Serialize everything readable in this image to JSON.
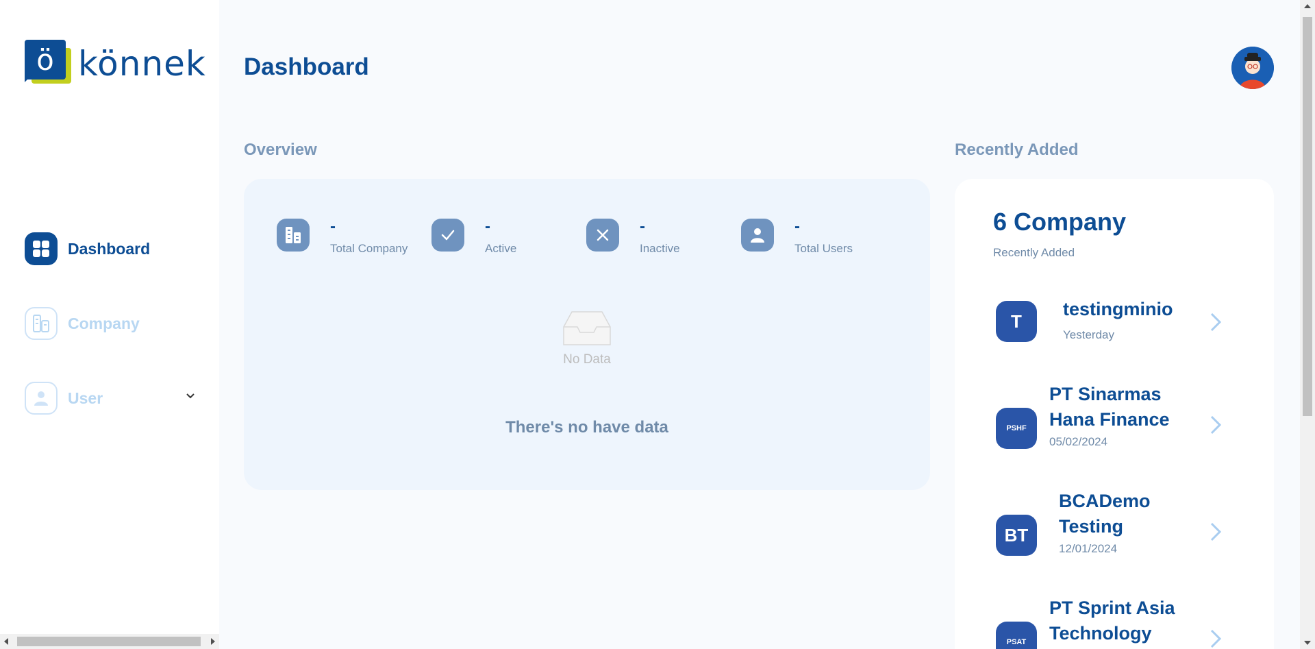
{
  "brand": {
    "name": "könnek",
    "mark": "ö",
    "colors": {
      "primary": "#0d4d94",
      "accent": "#c2cf1e",
      "muted": "#b8d7f2"
    }
  },
  "sidebar": {
    "items": [
      {
        "label": "Dashboard",
        "icon": "dashboard-grid-icon",
        "active": true
      },
      {
        "label": "Company",
        "icon": "company-building-icon",
        "active": false
      },
      {
        "label": "User",
        "icon": "user-icon",
        "active": false,
        "expandable": true
      }
    ]
  },
  "header": {
    "title": "Dashboard",
    "avatar_icon": "user-avatar"
  },
  "overview": {
    "title": "Overview",
    "stats": [
      {
        "value": "-",
        "label": "Total Company",
        "icon": "company-building-icon"
      },
      {
        "value": "-",
        "label": "Active",
        "icon": "check-icon"
      },
      {
        "value": "-",
        "label": "Inactive",
        "icon": "x-icon"
      },
      {
        "value": "-",
        "label": "Total Users",
        "icon": "user-icon"
      }
    ],
    "empty_label": "No Data",
    "empty_message": "There's no have data"
  },
  "recent": {
    "title": "Recently Added",
    "count": "6 Company",
    "subtitle": "Recently Added",
    "items": [
      {
        "initials": "T",
        "name_lines": [
          "testingminio"
        ],
        "date": "Yesterday"
      },
      {
        "initials": "PSHF",
        "name_lines": [
          "PT Sinarmas",
          "Hana Finance"
        ],
        "date": "05/02/2024"
      },
      {
        "initials": "BT",
        "name_lines": [
          "BCADemo",
          "Testing"
        ],
        "date": "12/01/2024"
      },
      {
        "initials": "PSAT",
        "name_lines": [
          "PT Sprint Asia",
          "Technology"
        ],
        "date": ""
      }
    ]
  }
}
